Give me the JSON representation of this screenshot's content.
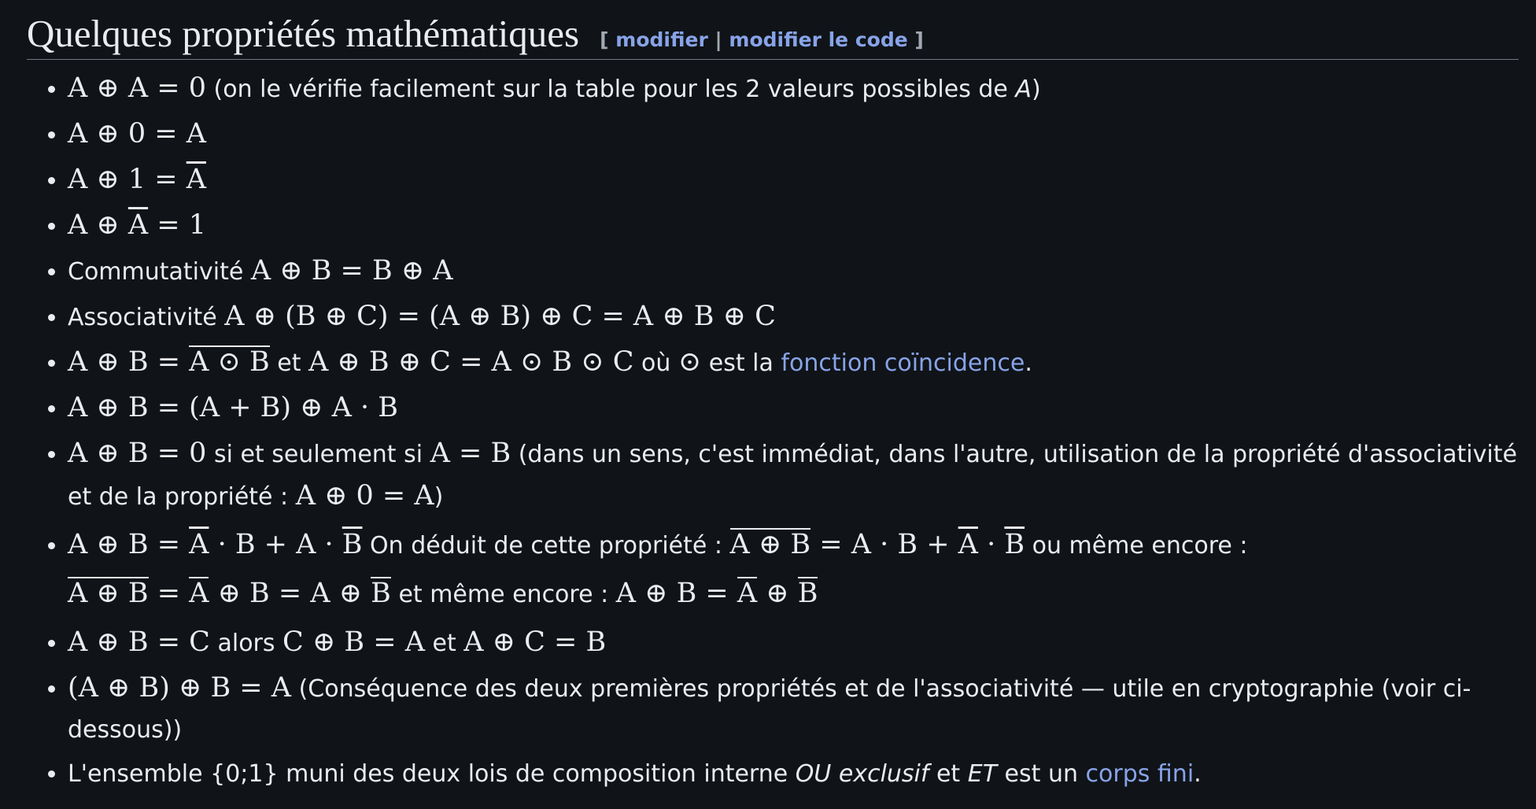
{
  "heading": {
    "title": "Quelques propriétés mathématiques",
    "edit_open": "[",
    "edit_label": "modifier",
    "edit_sep": "|",
    "edit_code_label": "modifier le code",
    "edit_close": "]"
  },
  "items": [
    {
      "m1": "A ⊕ A = 0",
      "t1": " (on le vérifie facilement sur la table pour les 2 valeurs possibles de ",
      "t1i": "A",
      "t2": ")"
    },
    {
      "m1": "A ⊕ 0 = A"
    },
    {
      "m1a": "A ⊕ 1 = ",
      "m1b": "A"
    },
    {
      "m1a": "A ⊕ ",
      "m1b": "A",
      "m1c": " = 1"
    },
    {
      "t1": "Commutativité ",
      "m1": "A ⊕ B = B ⊕ A"
    },
    {
      "t1": "Associativité ",
      "m1": "A ⊕ (B ⊕ C) = (A ⊕ B) ⊕ C = A ⊕ B ⊕ C"
    },
    {
      "m1a": "A ⊕ B = ",
      "m1b": "A ⊙ B",
      "t1": " et ",
      "m2": "A ⊕ B ⊕ C = A ⊙ B ⊙ C",
      "t2": " où ",
      "m3": "⊙",
      "t3": " est la ",
      "link": "fonction coïncidence",
      "t4": "."
    },
    {
      "m1": "A ⊕ B = (A + B) ⊕ A · B"
    },
    {
      "m1": "A ⊕ B = 0",
      "t1": " si et seulement si ",
      "m2": "A = B",
      "t2": " (dans un sens, c'est immédiat, dans l'autre, utilisation de la propriété d'associativité et de la propriété : ",
      "m3": "A ⊕ 0 = A",
      "t3": ")"
    },
    {
      "m1a": "A ⊕ B = ",
      "m1b": "A",
      "m1c": " · B + A · ",
      "m1d": "B",
      "t1": " On déduit de cette propriété : ",
      "m2a": "A ⊕ B",
      "m2b": " = A · B + ",
      "m2c": "A",
      "m2d": " · ",
      "m2e": "B",
      "t2": " ou même encore : ",
      "m3a": "A ⊕ B",
      "m3b": " = ",
      "m3c": "A",
      "m3d": " ⊕ B = A ⊕ ",
      "m3e": "B",
      "t3": " et même encore : ",
      "m4a": "A ⊕ B = ",
      "m4b": "A",
      "m4c": " ⊕ ",
      "m4d": "B"
    },
    {
      "m1": "A ⊕ B = C",
      "t1": " alors ",
      "m2": "C ⊕ B = A",
      "t2": " et ",
      "m3": "A ⊕ C = B"
    },
    {
      "m1": "(A ⊕ B) ⊕ B = A",
      "t1": " (Conséquence des deux premières propriétés et de l'associativité — utile en cryptographie (voir ci-dessous))"
    },
    {
      "t1": "L'ensemble {0;1} muni des deux lois de composition interne ",
      "t1i": "OU exclusif",
      "t2": " et ",
      "t2i": "ET",
      "t3": " est un ",
      "link": "corps fini",
      "t4": "."
    }
  ]
}
